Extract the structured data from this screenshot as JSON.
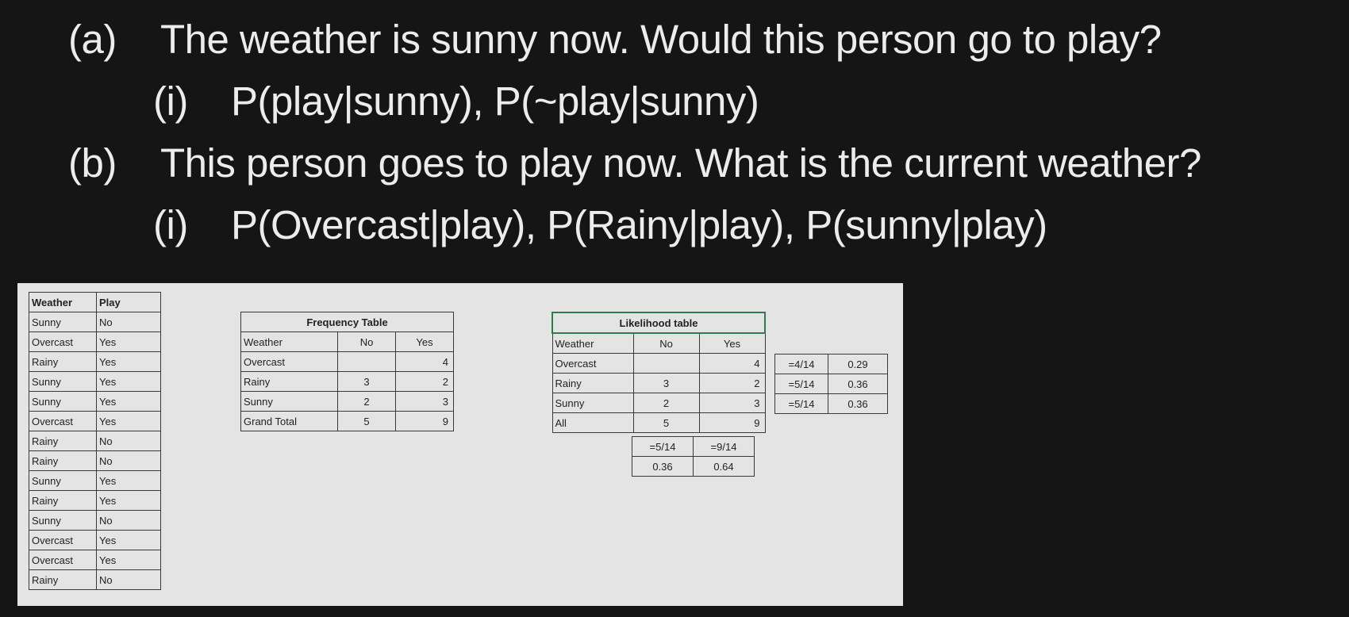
{
  "questions": {
    "a": {
      "label": "(a)",
      "text": "The weather is sunny now. Would this person go to play?"
    },
    "a_i": {
      "label": "(i)",
      "text": "P(play|sunny), P(~play|sunny)"
    },
    "b": {
      "label": "(b)",
      "text": "This person goes to play now. What is the current weather?"
    },
    "b_i": {
      "label": "(i)",
      "text": "P(Overcast|play), P(Rainy|play), P(sunny|play)"
    }
  },
  "data_table": {
    "headers": [
      "Weather",
      "Play"
    ],
    "rows": [
      [
        "Sunny",
        "No"
      ],
      [
        "Overcast",
        "Yes"
      ],
      [
        "Rainy",
        "Yes"
      ],
      [
        "Sunny",
        "Yes"
      ],
      [
        "Sunny",
        "Yes"
      ],
      [
        "Overcast",
        "Yes"
      ],
      [
        "Rainy",
        "No"
      ],
      [
        "Rainy",
        "No"
      ],
      [
        "Sunny",
        "Yes"
      ],
      [
        "Rainy",
        "Yes"
      ],
      [
        "Sunny",
        "No"
      ],
      [
        "Overcast",
        "Yes"
      ],
      [
        "Overcast",
        "Yes"
      ],
      [
        "Rainy",
        "No"
      ]
    ]
  },
  "frequency_table": {
    "title": "Frequency Table",
    "headers": [
      "Weather",
      "No",
      "Yes"
    ],
    "rows": [
      [
        "Overcast",
        "",
        "4"
      ],
      [
        "Rainy",
        "3",
        "2"
      ],
      [
        "Sunny",
        "2",
        "3"
      ],
      [
        "Grand Total",
        "5",
        "9"
      ]
    ]
  },
  "likelihood_table": {
    "title": "Likelihood table",
    "headers": [
      "Weather",
      "No",
      "Yes"
    ],
    "rows": [
      [
        "Overcast",
        "",
        "4"
      ],
      [
        "Rainy",
        "3",
        "2"
      ],
      [
        "Sunny",
        "2",
        "3"
      ],
      [
        "All",
        "5",
        "9"
      ]
    ],
    "weather_prob": [
      [
        "=4/14",
        "0.29"
      ],
      [
        "=5/14",
        "0.36"
      ],
      [
        "=5/14",
        "0.36"
      ]
    ],
    "play_prob": [
      [
        "=5/14",
        "=9/14"
      ],
      [
        "0.36",
        "0.64"
      ]
    ]
  }
}
